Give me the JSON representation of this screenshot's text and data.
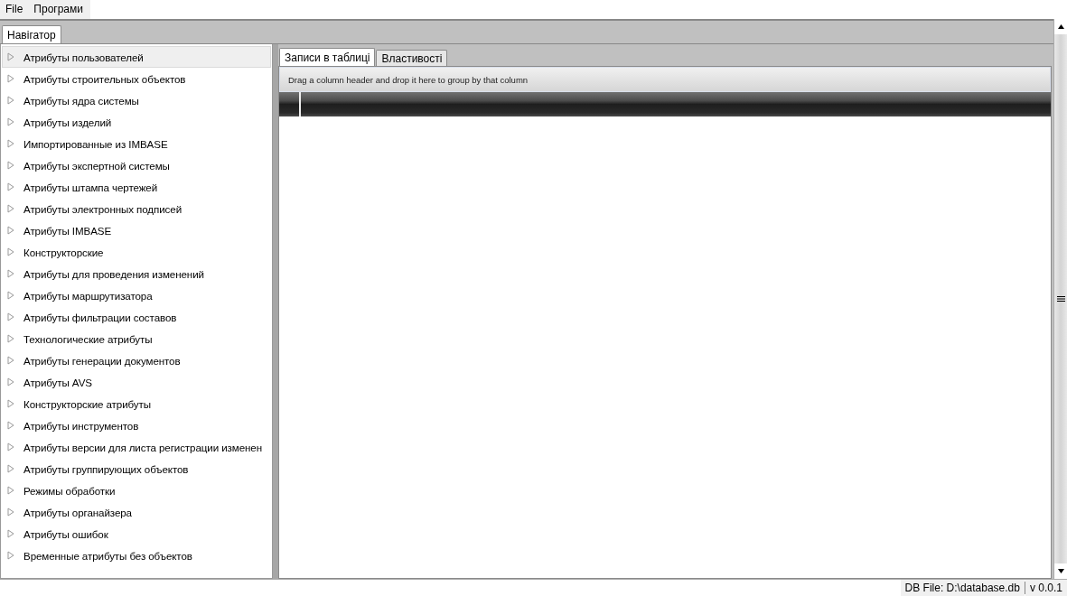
{
  "menu": [
    {
      "label": "File"
    },
    {
      "label": "Програми"
    }
  ],
  "left_tabs": [
    {
      "label": "Навігатор",
      "selected": true
    }
  ],
  "tree": {
    "items": [
      {
        "label": "Атрибуты пользователей",
        "selected": true,
        "expanded": false
      },
      {
        "label": "Атрибуты строительных объектов",
        "selected": false,
        "expanded": false
      },
      {
        "label": "Атрибуты ядра системы",
        "selected": false,
        "expanded": false
      },
      {
        "label": "Атрибуты изделий",
        "selected": false,
        "expanded": false
      },
      {
        "label": "Импортированные из IMBASE",
        "selected": false,
        "expanded": false
      },
      {
        "label": "Атрибуты экспертной системы",
        "selected": false,
        "expanded": false
      },
      {
        "label": "Атрибуты штампа чертежей",
        "selected": false,
        "expanded": false
      },
      {
        "label": "Атрибуты электронных подписей",
        "selected": false,
        "expanded": false
      },
      {
        "label": "Атрибуты IMBASE",
        "selected": false,
        "expanded": false
      },
      {
        "label": "Конструкторские",
        "selected": false,
        "expanded": false
      },
      {
        "label": "Атрибуты для проведения изменений",
        "selected": false,
        "expanded": false
      },
      {
        "label": "Атрибуты маршрутизатора",
        "selected": false,
        "expanded": false
      },
      {
        "label": "Атрибуты фильтрации составов",
        "selected": false,
        "expanded": false
      },
      {
        "label": "Технологические атрибуты",
        "selected": false,
        "expanded": false
      },
      {
        "label": "Атрибуты генерации документов",
        "selected": false,
        "expanded": false
      },
      {
        "label": "Атрибуты AVS",
        "selected": false,
        "expanded": false
      },
      {
        "label": "Конструкторские атрибуты",
        "selected": false,
        "expanded": false
      },
      {
        "label": "Атрибуты инструментов",
        "selected": false,
        "expanded": false
      },
      {
        "label": "Атрибуты версии для листа регистрации изменен",
        "selected": false,
        "expanded": false
      },
      {
        "label": "Атрибуты группирующих объектов",
        "selected": false,
        "expanded": false
      },
      {
        "label": "Режимы обработки",
        "selected": false,
        "expanded": false
      },
      {
        "label": "Атрибуты органайзера",
        "selected": false,
        "expanded": false
      },
      {
        "label": "Атрибуты ошибок",
        "selected": false,
        "expanded": false
      },
      {
        "label": "Временные атрибуты без объектов",
        "selected": false,
        "expanded": false
      }
    ]
  },
  "right_tabs": [
    {
      "label": "Записи в таблиці",
      "selected": true
    },
    {
      "label": "Властивості",
      "selected": false
    }
  ],
  "grid": {
    "group_panel_hint": "Drag a column header and drop it here to group by that column"
  },
  "status_bar": {
    "db_file": "DB File: D:\\database.db",
    "version": "v 0.0.1"
  }
}
